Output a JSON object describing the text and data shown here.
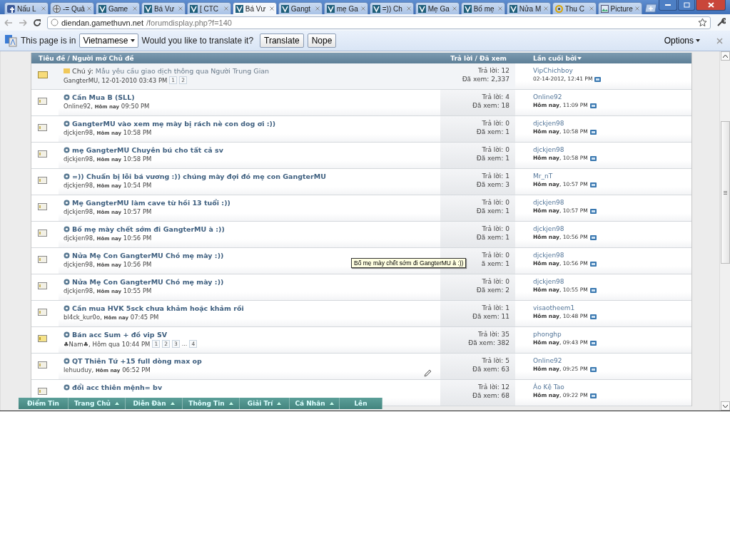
{
  "tabs": [
    {
      "title": "Nấu L",
      "selected": false
    },
    {
      "title": "-= Quả",
      "selected": false
    },
    {
      "title": "Game",
      "selected": false
    },
    {
      "title": "Bá Vư",
      "selected": false
    },
    {
      "title": "[ CTC",
      "selected": false
    },
    {
      "title": "Bá Vư",
      "selected": true
    },
    {
      "title": "Gangt",
      "selected": false
    },
    {
      "title": "mẹ Ga",
      "selected": false
    },
    {
      "title": "=)) Ch",
      "selected": false
    },
    {
      "title": "Mẹ Ga",
      "selected": false
    },
    {
      "title": "Bố mẹ",
      "selected": false
    },
    {
      "title": "Nửa M",
      "selected": false
    },
    {
      "title": "Thu C",
      "selected": false
    },
    {
      "title": "Picture",
      "selected": false
    }
  ],
  "address": {
    "host": "diendan.gamethuvn.net",
    "path": "/forumdisplay.php?f=140"
  },
  "translate_bar": {
    "intro": "This page is in",
    "language": "Vietnamese",
    "question": "Would you like to translate it?",
    "buttons": [
      "Translate",
      "Nope"
    ],
    "options": "Options"
  },
  "table": {
    "columns": [
      "Tiêu đề / Người mở Chủ đề",
      "Trả lời / Đã xem",
      "Lần cuối bởi"
    ],
    "rows": [
      {
        "kind": "sticky",
        "prefix": "Chú ý:",
        "title": "Mẫu yêu cầu giao dịch thông qua Người Trung Gian",
        "meta": "GangterMU, 12-01-2010 03:43 PM",
        "pages": [
          "1",
          "2"
        ],
        "edit_icon": false,
        "replies": "Trả lời: 12",
        "views": "Đã xem: 2,337",
        "last_by": "VipChichboy",
        "last_time": "02-14-2012, 12:41 PM"
      },
      {
        "kind": "normal",
        "title": "Cần Mua B (SLL)",
        "meta": "Online92, **Hôm nay** 09:50 PM",
        "edit_icon": false,
        "replies": "Trả lời: 4",
        "views": "Đã xem: 18",
        "last_by": "Online92",
        "last_time": "**Hôm nay**, 11:09 PM"
      },
      {
        "kind": "normal",
        "title": "GangterMU vào xem mẹ mày bị rách nè con dog ơi :))",
        "meta": "djckjen98, **Hôm nay** 10:58 PM",
        "edit_icon": false,
        "replies": "Trả lời: 0",
        "views": "Đã xem: 1",
        "last_by": "djckjen98",
        "last_time": "**Hôm nay**, 10:58 PM"
      },
      {
        "kind": "normal",
        "title": "mẹ GangterMU Chuyên bú cho tất cả sv",
        "meta": "djckjen98, **Hôm nay** 10:58 PM",
        "edit_icon": false,
        "replies": "Trả lời: 0",
        "views": "Đã xem: 1",
        "last_by": "djckjen98",
        "last_time": "**Hôm nay**, 10:58 PM"
      },
      {
        "kind": "normal",
        "title": "=)) Chuẩn bị lỗi bá vương :)) chúng mày đợi đó mẹ con GangterMU",
        "meta": "djckjen98, **Hôm nay** 10:54 PM",
        "edit_icon": false,
        "replies": "Trả lời: 1",
        "views": "Đã xem: 3",
        "last_by": "Mr_nT",
        "last_time": "**Hôm nay**, 10:57 PM"
      },
      {
        "kind": "normal",
        "title": "Mẹ GangterMU làm cave từ hồi 13 tuổi :))",
        "meta": "djckjen98, **Hôm nay** 10:57 PM",
        "edit_icon": false,
        "replies": "Trả lời: 0",
        "views": "Đã xem: 1",
        "last_by": "djckjen98",
        "last_time": "**Hôm nay**, 10:57 PM"
      },
      {
        "kind": "normal",
        "title": "Bố mẹ mày chết sớm đi GangterMU à :))",
        "meta": "djckjen98, **Hôm nay** 10:56 PM",
        "edit_icon": false,
        "replies": "Trả lời: 0",
        "views": "Đã xem: 1",
        "last_by": "djckjen98",
        "last_time": "**Hôm nay**, 10:56 PM"
      },
      {
        "kind": "normal",
        "title": "Nửa Mẹ Con GangterMU Chó mẹ mày :))",
        "meta": "djckjen98, **Hôm nay** 10:56 PM",
        "edit_icon": false,
        "replies": "Trả lời: 0",
        "views": "ã xem: 1",
        "last_by": "djckjen98",
        "last_time": "**Hôm nay**, 10:56 PM"
      },
      {
        "kind": "normal",
        "title": "Nửa Mẹ Con GangterMU Chó mẹ mày :))",
        "meta": "djckjen98, **Hôm nay** 10:55 PM",
        "edit_icon": false,
        "replies": "Trả lời: 0",
        "views": "Đã xem: 2",
        "last_by": "djckjen98",
        "last_time": "**Hôm nay**, 10:55 PM"
      },
      {
        "kind": "normal",
        "title": "Cần mua HVK 5sck chưa khảm hoặc khảm rồi",
        "meta": "bl4ck_kur0o, **Hôm nay** 07:45 PM",
        "edit_icon": false,
        "replies": "Trả lời: 1",
        "views": "Đã xem: 11",
        "last_by": "visaotheem1",
        "last_time": "**Hôm nay**, 10:48 PM"
      },
      {
        "kind": "hot",
        "title": "Bán acc Sum + đồ vip SV",
        "meta": "♣Nam♣, Hôm qua 10:44 PM",
        "pages": [
          "1",
          "2",
          "3",
          "...",
          "4"
        ],
        "edit_icon": false,
        "replies": "Trả lời: 35",
        "views": "Đã xem: 382",
        "last_by": "phonghp",
        "last_time": "**Hôm nay**, 09:43 PM"
      },
      {
        "kind": "normal",
        "title": "QT Thiên Tứ +15 full dòng max op",
        "meta": "lehuuduy, **Hôm nay** 06:52 PM",
        "edit_icon": true,
        "replies": "Trả lời: 5",
        "views": "Đã xem: 63",
        "last_by": "Online92",
        "last_time": "**Hôm nay**, 09:25 PM"
      },
      {
        "kind": "normal",
        "title": "đổi acc thiên mệnh= bv",
        "edit_icon": false,
        "replies": "Trả lời: 12",
        "views": "Đã xem: 68",
        "last_by": "Ảo Kệ Tao",
        "last_time": "**Hôm nay**, 09:22 PM"
      }
    ]
  },
  "tooltip": "Bố mẹ mày chết sớm đi GangterMU à :))",
  "bottom_nav": [
    {
      "label": "Điểm Tin",
      "dropdown": false
    },
    {
      "label": "Trang Chủ",
      "dropdown": true
    },
    {
      "label": "Diễn Đàn",
      "dropdown": true
    },
    {
      "label": "Thông Tin",
      "dropdown": true
    },
    {
      "label": "Giải Trí",
      "dropdown": true
    },
    {
      "label": "Cá Nhân",
      "dropdown": true
    },
    {
      "label": "Lên",
      "dropdown": false
    }
  ]
}
